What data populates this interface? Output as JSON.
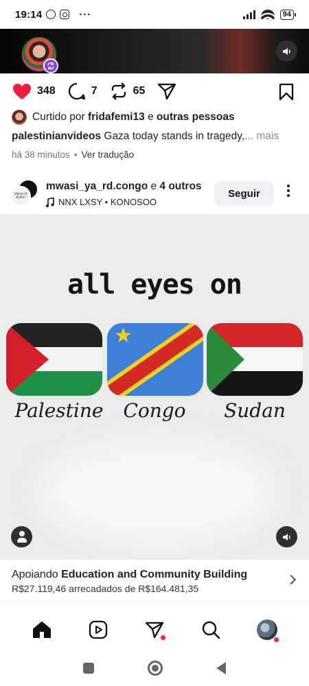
{
  "status_bar": {
    "time": "19:14",
    "dots": "···",
    "battery": "94"
  },
  "post1": {
    "likes": "348",
    "comments": "7",
    "reposts": "65",
    "liked_by_prefix": "Curtido por ",
    "liked_by_user": "fridafemi13",
    "liked_by_connector": " e ",
    "liked_by_others": "outras pessoas",
    "caption_user": "palestinianvideos",
    "caption_text": " Gaza today stands in tragedy,",
    "caption_more": "... mais",
    "time_ago": "há 38 minutos",
    "translate": "Ver tradução"
  },
  "post2": {
    "usernames": "mwasi_ya_rd.congo",
    "connector": " e ",
    "others": "4 outros",
    "music": "NNX LXSY • KONOSOO",
    "follow_label": "Seguir",
    "avatar_small_text": "Vision of Action",
    "media": {
      "headline": "all eyes on",
      "countries": [
        "Palestine",
        "Congo",
        "Sudan"
      ]
    }
  },
  "fundraiser": {
    "prefix": "Apoiando ",
    "cause": "Education and Community Building",
    "amount": "R$27.119,46 arrecadados de R$164.481,35"
  },
  "nav": {
    "items": [
      "home-icon",
      "reels-icon",
      "direct-messages-icon",
      "search-icon",
      "profile-avatar"
    ]
  },
  "colors": {
    "like_red": "#ee1d3e",
    "notification_red": "#ff1f4b",
    "repost_badge": "#8a3cf0",
    "follow_button_bg": "#eff1f5"
  }
}
